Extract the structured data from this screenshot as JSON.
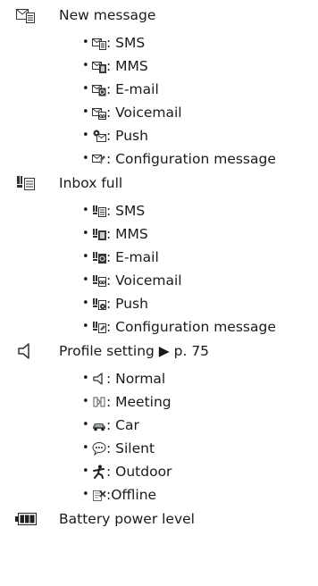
{
  "sections": [
    {
      "title": "New message",
      "icon": "new-message-icon",
      "items": [
        {
          "icon": "sms-envelope-icon",
          "text": ": SMS"
        },
        {
          "icon": "mms-envelope-icon",
          "text": ": MMS"
        },
        {
          "icon": "email-envelope-icon",
          "text": ": E-mail"
        },
        {
          "icon": "voicemail-envelope-icon",
          "text": ": Voicemail"
        },
        {
          "icon": "push-message-icon",
          "text": ": Push"
        },
        {
          "icon": "configuration-message-icon",
          "text": ": Configuration message"
        }
      ]
    },
    {
      "title": "Inbox full",
      "icon": "inbox-full-icon",
      "items": [
        {
          "icon": "inbox-full-sms-icon",
          "text": ": SMS"
        },
        {
          "icon": "inbox-full-mms-icon",
          "text": ": MMS"
        },
        {
          "icon": "inbox-full-email-icon",
          "text": ": E-mail"
        },
        {
          "icon": "inbox-full-voicemail-icon",
          "text": ": Voicemail"
        },
        {
          "icon": "inbox-full-push-icon",
          "text": ": Push"
        },
        {
          "icon": "inbox-full-configuration-icon",
          "text": ": Configuration message"
        }
      ]
    },
    {
      "title": "Profile setting ▶ p. 75",
      "icon": "speaker-icon",
      "items": [
        {
          "icon": "normal-speaker-icon",
          "text": " : Normal"
        },
        {
          "icon": "meeting-icon",
          "text": ": Meeting"
        },
        {
          "icon": "car-icon",
          "text": ": Car"
        },
        {
          "icon": "silent-icon",
          "text": ": Silent"
        },
        {
          "icon": "outdoor-icon",
          "text": ": Outdoor"
        },
        {
          "icon": "offline-icon",
          "text": ":Offline"
        }
      ]
    },
    {
      "title": "Battery power level",
      "icon": "battery-icon",
      "items": []
    }
  ]
}
